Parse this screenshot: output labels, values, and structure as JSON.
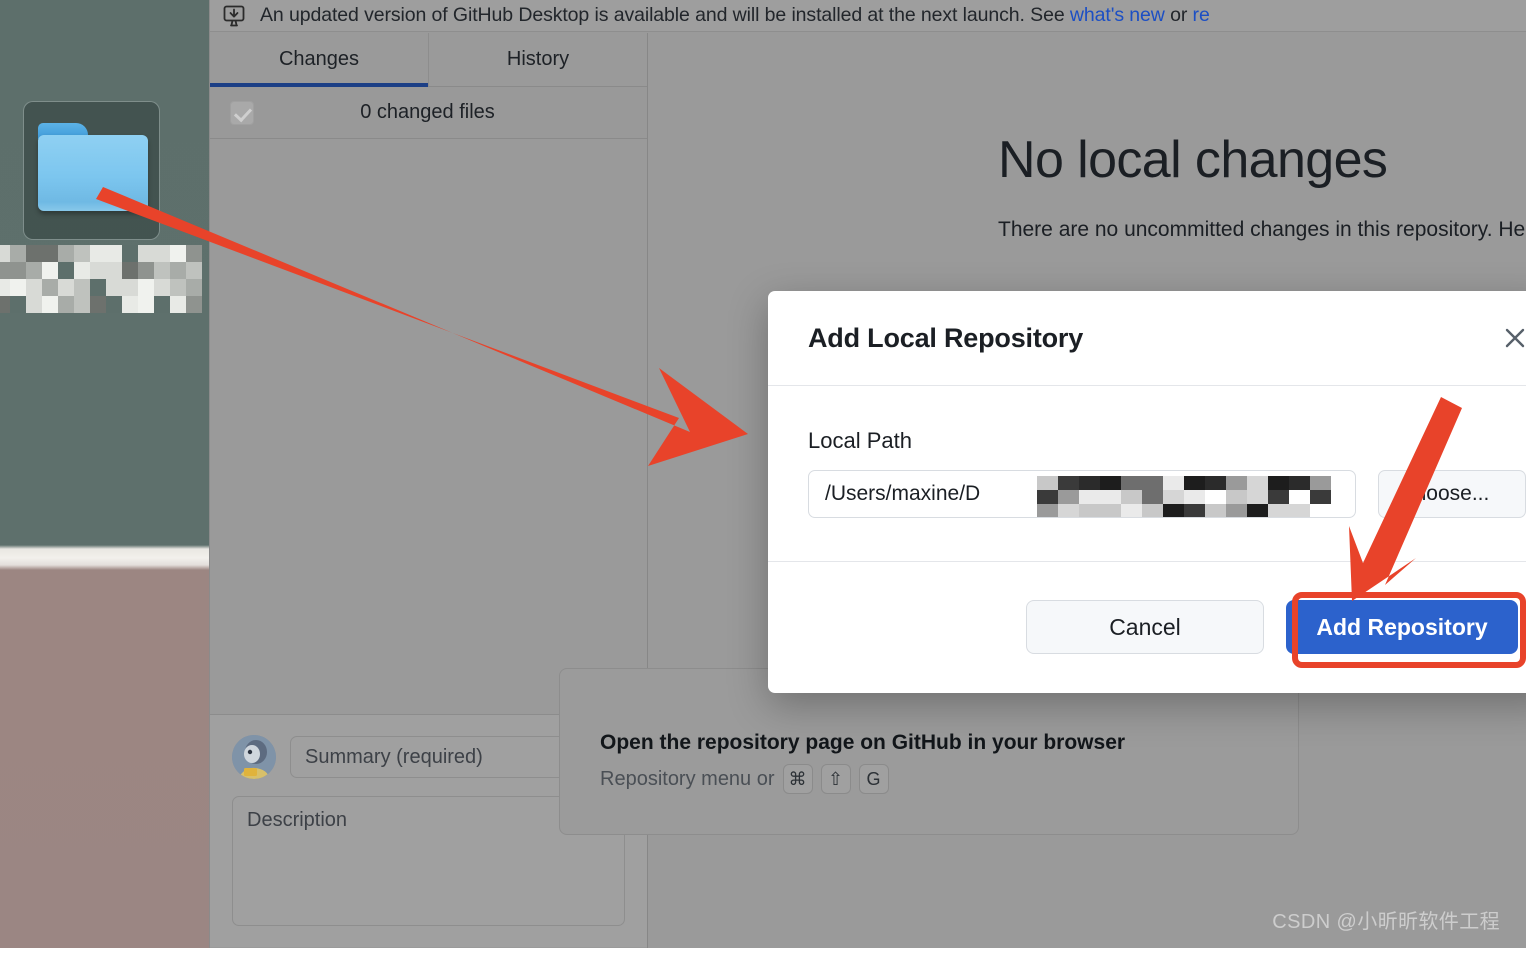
{
  "desktop": {
    "folder_icon_name": "blue-folder-icon",
    "folder_label": "",
    "wallpaper_top_color": "#5d6f6b",
    "wallpaper_bottom_color": "#9b8683"
  },
  "app": {
    "update_banner": {
      "icon": "desktop-download-icon",
      "text_before": "An updated version of GitHub Desktop is available and will be installed at the next launch. See ",
      "link1": "what's new",
      "text_mid": " or ",
      "link2": "re"
    },
    "tabs": [
      {
        "label": "Changes",
        "active": true
      },
      {
        "label": "History",
        "active": false
      }
    ],
    "changed_files": {
      "checkbox_state": "checked",
      "label": "0 changed files"
    },
    "commit": {
      "avatar": "user-avatar",
      "summary_placeholder": "Summary (required)",
      "description_placeholder": "Description"
    },
    "main": {
      "title": "No local changes",
      "description": "There are no uncommitted changes in this repository. Here are so for what to do next.",
      "suggestion": {
        "title": "Open the repository page on GitHub in your browser",
        "prefix": "Repository menu or",
        "keys": [
          "⌘",
          "⇧",
          "G"
        ]
      }
    }
  },
  "dialog": {
    "title": "Add Local Repository",
    "close_icon": "close-icon",
    "local_path_label": "Local Path",
    "path_value": "/Users/maxine/D",
    "path_value_tail": "(",
    "choose_button": "hoose...",
    "cancel_button": "Cancel",
    "add_button": "Add Repository",
    "accent_color": "#2c62cc"
  },
  "annotations": {
    "arrow_color": "#e8432a",
    "highlight_color": "#e8432a",
    "arrow1_name": "arrow-folder-to-dialog",
    "arrow2_name": "arrow-to-add-repository"
  },
  "watermark": "CSDN @小昕昕软件工程"
}
